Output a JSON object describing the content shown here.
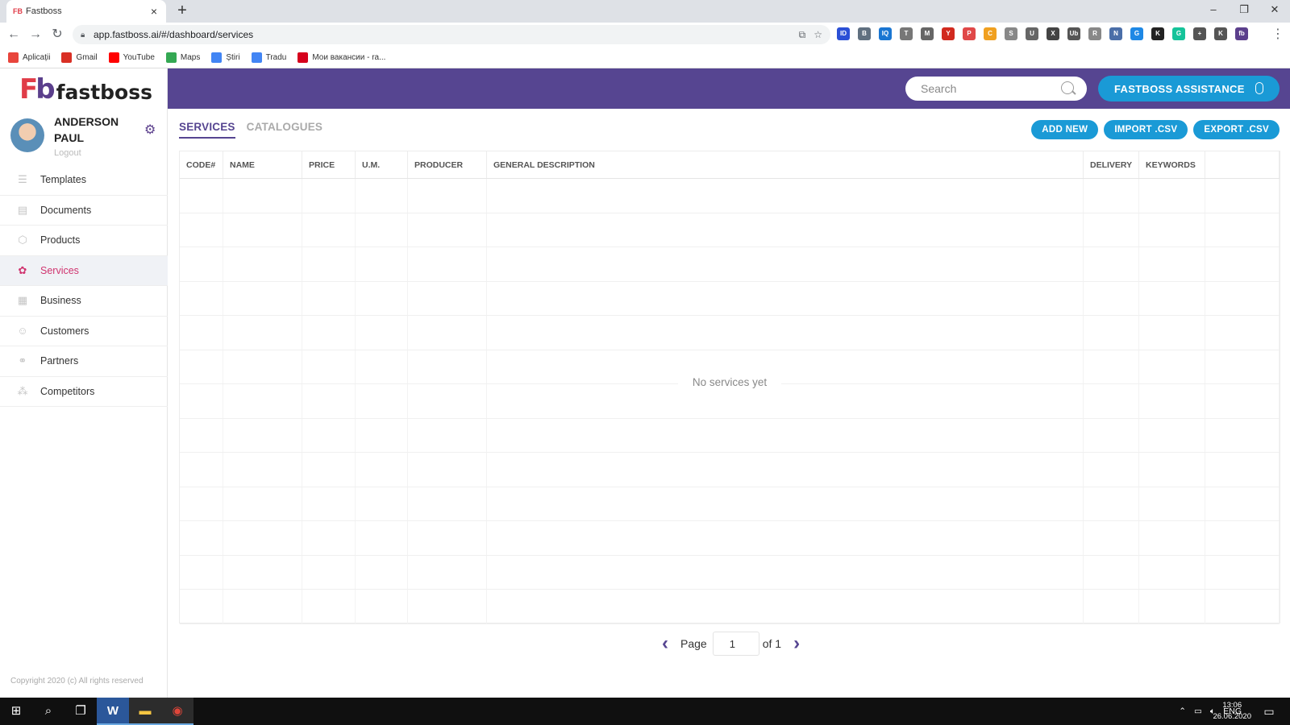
{
  "browser": {
    "tab_title": "Fastboss",
    "tab_favicon": "FB",
    "url": "app.fastboss.ai/#/dashboard/services",
    "extensions": [
      {
        "icon": "ID",
        "color": "#2b50d6"
      },
      {
        "icon": "B",
        "color": "#607080"
      },
      {
        "icon": "IQ",
        "color": "#1a76d2"
      },
      {
        "icon": "T",
        "color": "#777777"
      },
      {
        "icon": "M",
        "color": "#666666"
      },
      {
        "icon": "Y",
        "color": "#d12a1f"
      },
      {
        "icon": "P",
        "color": "#e04848"
      },
      {
        "icon": "C",
        "color": "#f0a020"
      },
      {
        "icon": "S",
        "color": "#888888"
      },
      {
        "icon": "U",
        "color": "#666666"
      },
      {
        "icon": "X",
        "color": "#444444"
      },
      {
        "icon": "Ub",
        "color": "#555555"
      },
      {
        "icon": "R",
        "color": "#888888"
      },
      {
        "icon": "N",
        "color": "#4a6ea8"
      },
      {
        "icon": "G",
        "color": "#1e88e5"
      },
      {
        "icon": "K",
        "color": "#222222"
      },
      {
        "icon": "G",
        "color": "#15c39a"
      },
      {
        "icon": "+",
        "color": "#555555"
      },
      {
        "icon": "K",
        "color": "#555555"
      },
      {
        "icon": "fb",
        "color": "#5b3f8c"
      }
    ],
    "bookmarks": [
      {
        "label": "Aplicații",
        "icon": "apps-icon",
        "color": "#e8453c"
      },
      {
        "label": "Gmail",
        "icon": "gmail-icon",
        "color": "#d93025"
      },
      {
        "label": "YouTube",
        "icon": "youtube-icon",
        "color": "#ff0000"
      },
      {
        "label": "Maps",
        "icon": "maps-icon",
        "color": "#34a853"
      },
      {
        "label": "Știri",
        "icon": "news-icon",
        "color": "#4285f4"
      },
      {
        "label": "Tradu",
        "icon": "translate-icon",
        "color": "#4285f4"
      },
      {
        "label": "Мои вакансии - ra...",
        "icon": "hh-icon",
        "color": "#d6001c"
      }
    ]
  },
  "app": {
    "logo": {
      "mark_f": "F",
      "mark_b": "b",
      "text": "fastboss"
    },
    "user": {
      "name": "ANDERSON PAUL",
      "logout": "Logout"
    },
    "menu": [
      {
        "label": "Templates",
        "icon": "☰",
        "active": false
      },
      {
        "label": "Documents",
        "icon": "▤",
        "active": false
      },
      {
        "label": "Products",
        "icon": "⬡",
        "active": false
      },
      {
        "label": "Services",
        "icon": "✿",
        "active": true
      },
      {
        "label": "Business",
        "icon": "▦",
        "active": false
      },
      {
        "label": "Customers",
        "icon": "☺",
        "active": false
      },
      {
        "label": "Partners",
        "icon": "⚭",
        "active": false
      },
      {
        "label": "Competitors",
        "icon": "⁂",
        "active": false
      }
    ],
    "copyright": "Copyright 2020 (c) All rights reserved",
    "search_placeholder": "Search",
    "assistant_label": "FASTBOSS ASSISTANCE",
    "tabs": [
      {
        "label": "SERVICES",
        "active": true
      },
      {
        "label": "CATALOGUES",
        "active": false
      }
    ],
    "actions": [
      "ADD NEW",
      "IMPORT .CSV",
      "EXPORT .CSV"
    ],
    "columns": [
      "CODE#",
      "NAME",
      "PRICE",
      "U.M.",
      "PRODUCER",
      "GENERAL DESCRIPTION",
      "DELIVERY",
      "KEYWORDS",
      ""
    ],
    "empty_message": "No services yet",
    "pager": {
      "page_label": "Page",
      "current": "1",
      "of_label": "of 1"
    },
    "accent_color": "#564591",
    "button_color": "#1a9ad6",
    "active_menu_color": "#d0346f"
  },
  "taskbar": {
    "apps": [
      {
        "icon": "⊞",
        "name": "start-icon"
      },
      {
        "icon": "⌕",
        "name": "search-icon"
      },
      {
        "icon": "❐",
        "name": "task-view-icon"
      },
      {
        "icon": "W",
        "name": "word-icon"
      },
      {
        "icon": "▬",
        "name": "file-explorer-icon"
      },
      {
        "icon": "◉",
        "name": "chrome-icon"
      }
    ],
    "language": "ENG",
    "time": "13:06",
    "date": "26.06.2020"
  }
}
